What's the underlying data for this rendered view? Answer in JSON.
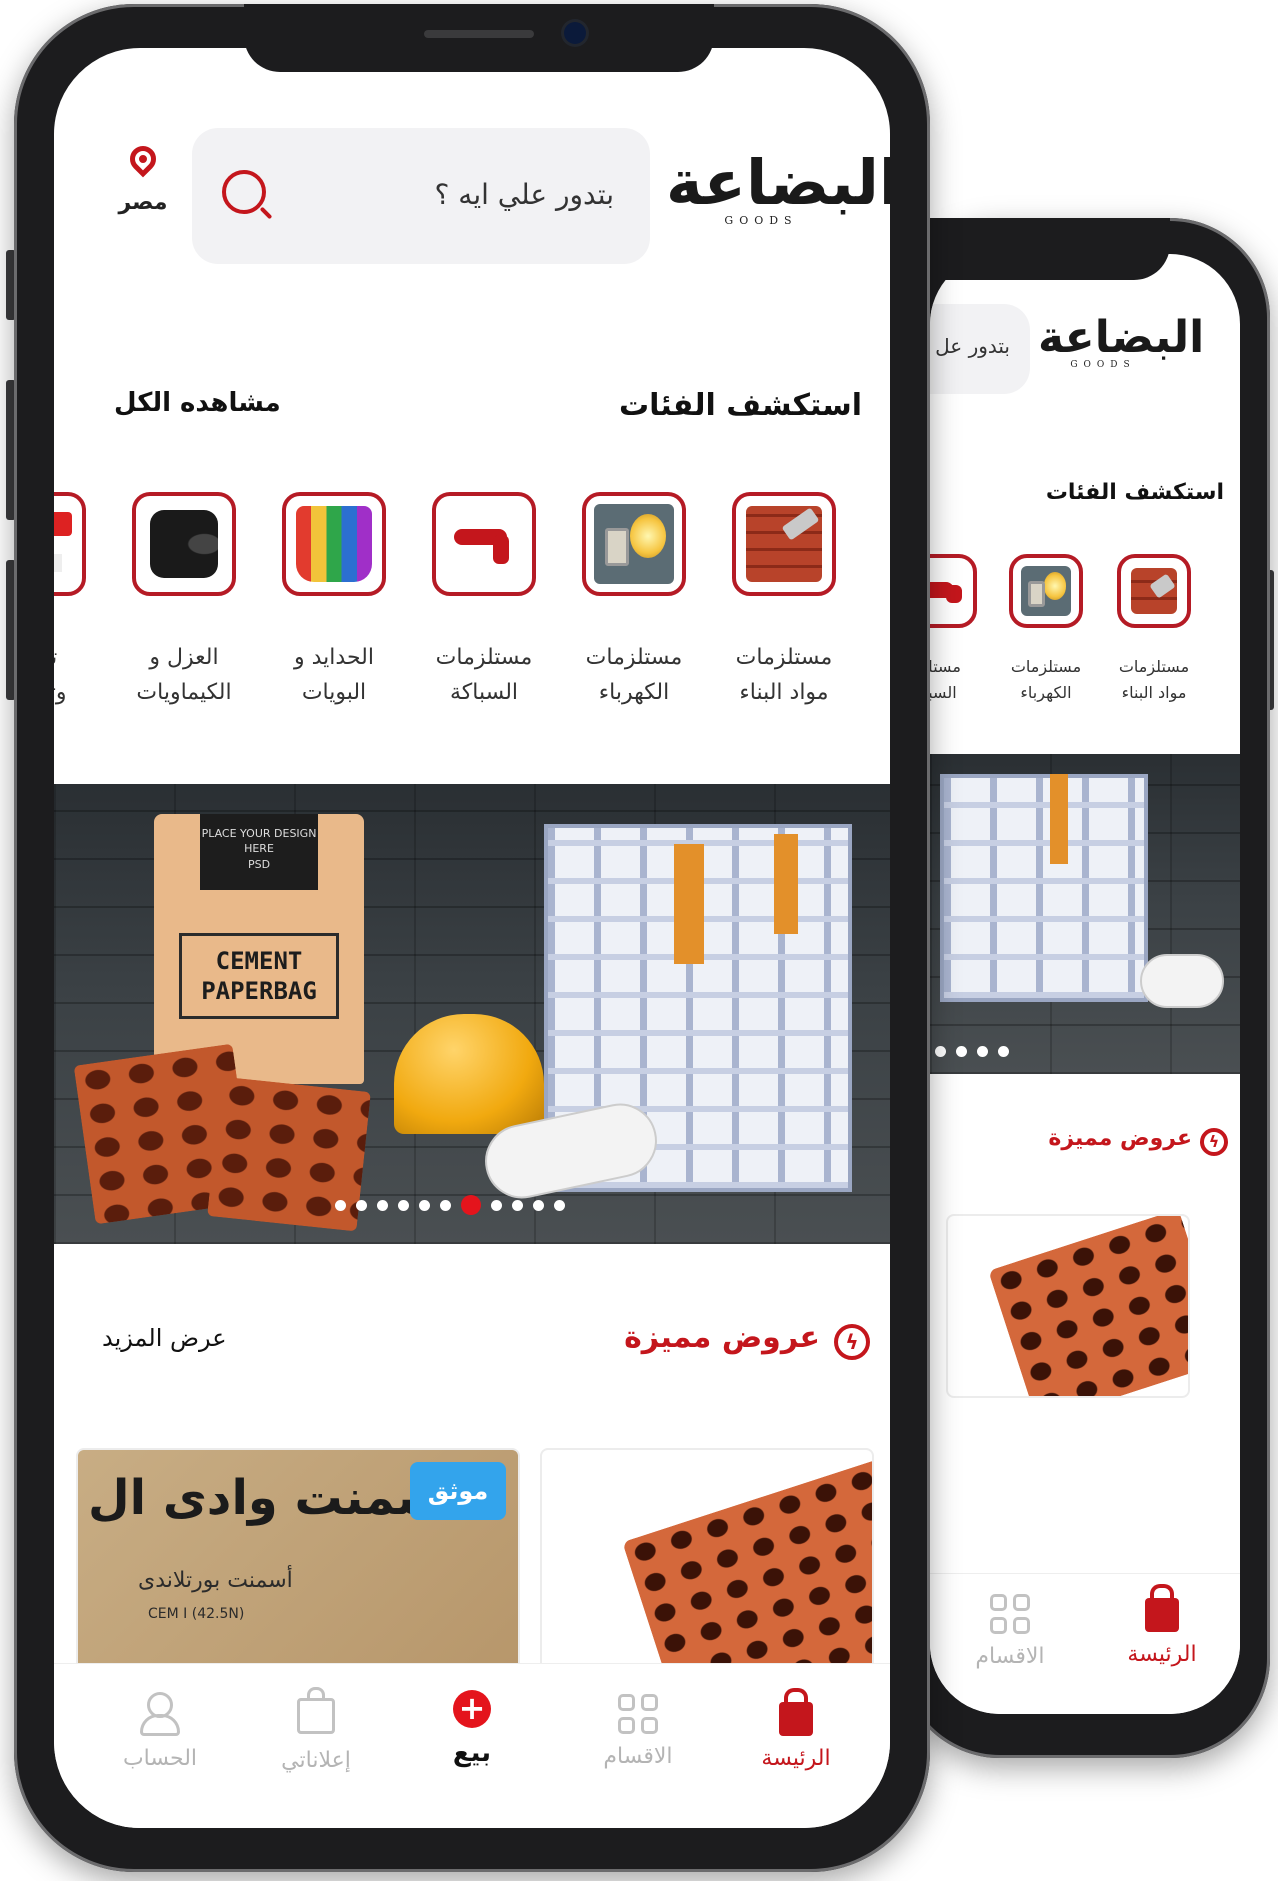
{
  "brand": {
    "logo_ar": "البضاعة",
    "logo_en": "GOODS",
    "accent": "#c4161c"
  },
  "header": {
    "search_placeholder": "بتدور علي ايه ؟",
    "search_placeholder_short": "بتدور عل",
    "location": "مصر"
  },
  "categories_section": {
    "title": "استكشف الفئات",
    "see_all": "مشاهده الكل",
    "items": [
      {
        "line1": "مستلزمات",
        "line2": "مواد البناء",
        "icon": "bricks-trowel"
      },
      {
        "line1": "مستلزمات",
        "line2": "الكهرباء",
        "icon": "light-bulb-switch"
      },
      {
        "line1": "مستلزمات",
        "line2": "السباكة",
        "icon": "water-tap"
      },
      {
        "line1": "الحدايد و",
        "line2": "البويات",
        "icon": "paint-buckets"
      },
      {
        "line1": "العزل و",
        "line2": "الكيماويات",
        "icon": "insulation-roll"
      },
      {
        "line1": "تدفئة",
        "line2": "وتكييف",
        "icon": "air-conditioner"
      }
    ],
    "back_items": [
      {
        "line1": "مستلزمات",
        "line2": "مواد البناء"
      },
      {
        "line1": "مستلزمات",
        "line2": "الكهرباء"
      },
      {
        "line1": "مستلز",
        "line2": "السبا"
      }
    ]
  },
  "banner": {
    "bag_top": "PLACE YOUR DESIGN HERE",
    "bag_psd": "PSD",
    "bag_text_1": "CEMENT",
    "bag_text_2": "PAPERBAG",
    "slide_count": 11,
    "active_slide": 6
  },
  "featured": {
    "title": "عروض مميزة",
    "see_more": "عرض المزيد",
    "cards": [
      {
        "type": "bricks"
      },
      {
        "type": "cement",
        "badge": "موثق",
        "title": "أسمنت وادى ال",
        "subtitle": "أسمنت بورتلاندى",
        "spec": "CEM I (42.5N)"
      }
    ]
  },
  "bottom_nav": {
    "items": [
      {
        "label": "الرئيسة",
        "icon": "shopping-bag",
        "active": true
      },
      {
        "label": "الاقسام",
        "icon": "grid"
      },
      {
        "label": "بيع",
        "icon": "plus-circle"
      },
      {
        "label": "إعلاناتي",
        "icon": "bag-outline"
      },
      {
        "label": "الحساب",
        "icon": "user"
      }
    ]
  }
}
